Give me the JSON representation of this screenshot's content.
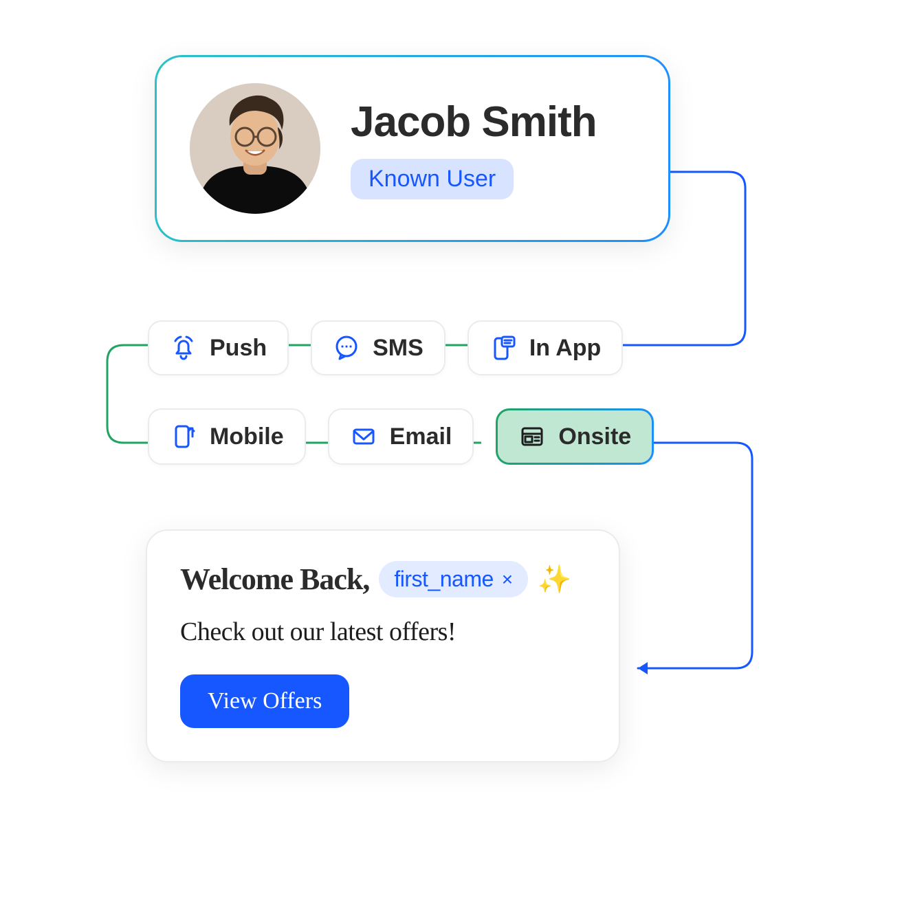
{
  "user": {
    "name": "Jacob Smith",
    "badge": "Known User"
  },
  "channels": {
    "row1": [
      {
        "id": "push",
        "label": "Push",
        "icon": "bell"
      },
      {
        "id": "sms",
        "label": "SMS",
        "icon": "chat"
      },
      {
        "id": "inapp",
        "label": "In App",
        "icon": "phone-msg"
      }
    ],
    "row2": [
      {
        "id": "mobile",
        "label": "Mobile",
        "icon": "phone"
      },
      {
        "id": "email",
        "label": "Email",
        "icon": "mail"
      },
      {
        "id": "onsite",
        "label": "Onsite",
        "icon": "layout",
        "selected": true
      }
    ]
  },
  "message": {
    "title_prefix": "Welcome Back,",
    "variable": "first_name",
    "sparkle": "✨",
    "subtitle": "Check out our latest offers!",
    "cta": "View Offers"
  },
  "colors": {
    "blue": "#1657ff",
    "teal": "#29c3c5",
    "green": "#1fa461",
    "green_light": "#bfe7d1"
  }
}
